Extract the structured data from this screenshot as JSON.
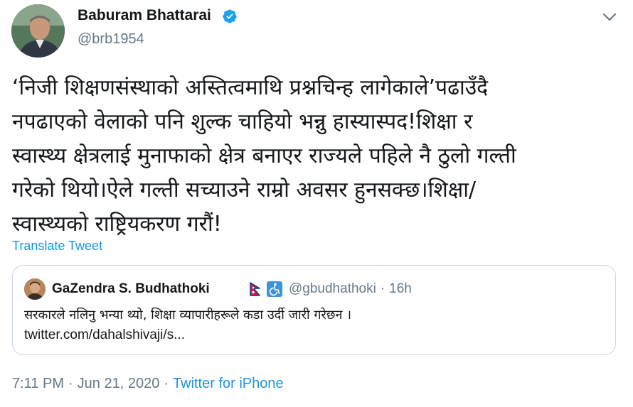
{
  "author": {
    "name": "Baburam Bhattarai",
    "handle": "@brb1954",
    "verified": true
  },
  "tweet": {
    "lines": [
      "‘निजी शिक्षणसंस्थाको अस्तित्वमाथि प्रश्नचिन्ह लागेकाले’पढाउँदै",
      "नपढाएको वेलाको पनि शुल्क चाहियो भन्नु हास्यास्पद!शिक्षा र",
      "स्वास्थ्य क्षेत्रलाई मुनाफाको क्षेत्र बनाएर राज्यले पहिले नै ठुलो गल्ती",
      "गरेको थियो।ऐले गल्ती सच्याउने राम्रो अवसर हुनसक्छ।शिक्षा/",
      "स्वास्थ्यको राष्ट्रियकरण गरौं!"
    ],
    "translate_label": "Translate Tweet"
  },
  "quoted_tweet": {
    "name": "GaZendra S. Budhathoki",
    "handle": "@gbudhathoki",
    "separator": "·",
    "time": "16h",
    "text": "सरकारले नलिनु भन्या थ्यो, शिक्षा व्यापारीहरूले कडा उर्दी जारी गरेछन ।",
    "link": "twitter.com/dahalshivaji/s..."
  },
  "footer": {
    "time": "7:11 PM",
    "separator": "·",
    "date": "Jun 21, 2020",
    "source": "Twitter for iPhone"
  },
  "colors": {
    "link": "#1b95e0",
    "verified": "#1da1f2",
    "muted": "#657786",
    "border": "#ccd6dd"
  },
  "icons": {
    "verified": "verified-badge-icon",
    "caret": "chevron-down-icon",
    "flag": "nepal-flag-icon",
    "wheelchair": "wheelchair-icon"
  }
}
